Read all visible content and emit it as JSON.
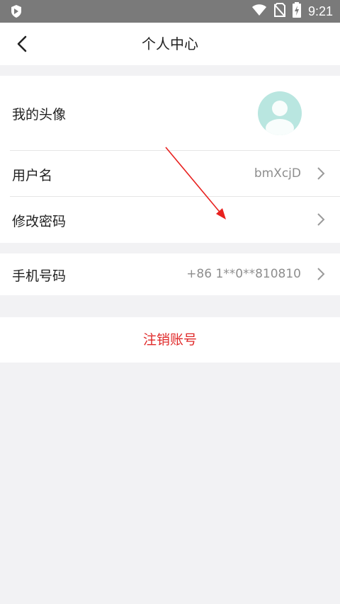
{
  "status_bar": {
    "time": "9:21"
  },
  "header": {
    "title": "个人中心"
  },
  "profile": {
    "avatar_label": "我的头像",
    "username_label": "用户名",
    "username_value": "bmXcjD",
    "change_password_label": "修改密码"
  },
  "phone": {
    "label": "手机号码",
    "value": "+86 1**0**810810"
  },
  "actions": {
    "deactivate_label": "注销账号"
  },
  "colors": {
    "accent_red": "#e02a2a",
    "avatar_bg": "#b9e6e0"
  }
}
